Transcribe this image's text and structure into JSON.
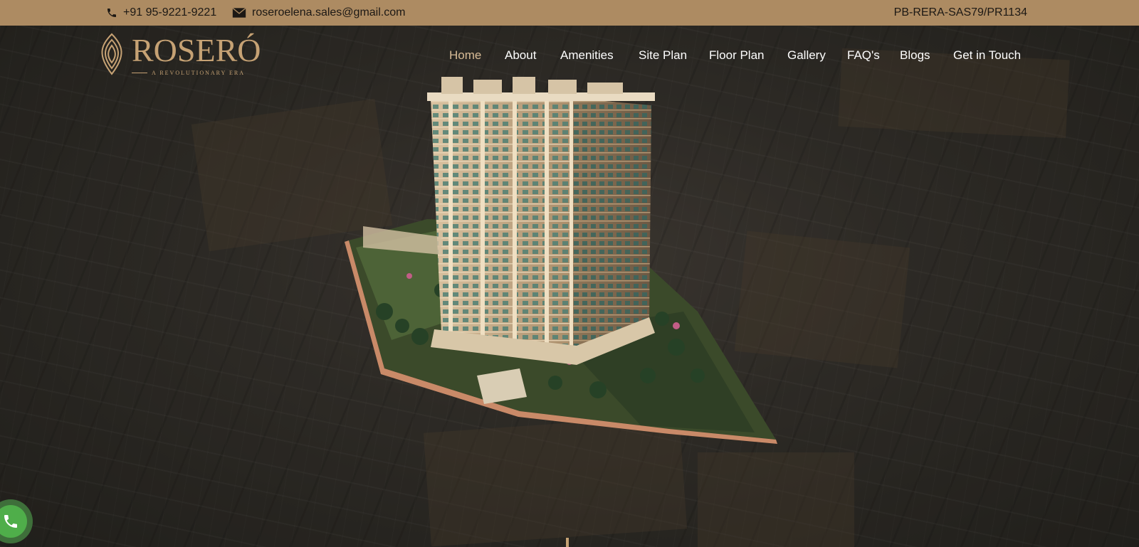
{
  "topbar": {
    "phone": "+91 95-9221-9221",
    "email": "roseroelena.sales@gmail.com",
    "rera": "PB-RERA-SAS79/PR1134",
    "icons": {
      "phone": "phone-icon",
      "email": "envelope-icon"
    }
  },
  "logo": {
    "name": "ROSERÓ",
    "tagline": "A REVOLUTIONARY ERA"
  },
  "nav": {
    "items": [
      {
        "label": "Home",
        "active": true
      },
      {
        "label": "About"
      },
      {
        "label": "Amenities"
      },
      {
        "label": "Site Plan"
      },
      {
        "label": "Floor Plan"
      },
      {
        "label": "Gallery"
      },
      {
        "label": "FAQ's"
      },
      {
        "label": "Blogs"
      },
      {
        "label": "Get in Touch"
      }
    ]
  },
  "colors": {
    "topbar": "#ad8b62",
    "gold": "#c6a274",
    "nav_active": "#d8bc96",
    "whatsapp": "#4fae4a"
  }
}
